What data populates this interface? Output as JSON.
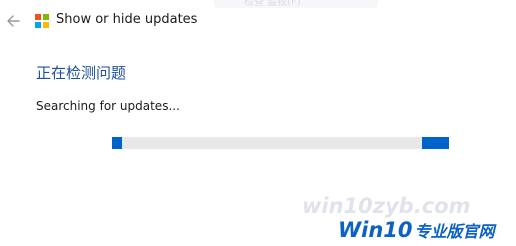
{
  "window": {
    "title": "Show or hide updates",
    "faded_search_text": "检查 监视(F)"
  },
  "icons": {
    "back": "back-arrow-icon",
    "logo": "microsoft-logo-icon"
  },
  "logo_colors": {
    "q1": "#f25022",
    "q2": "#7fba00",
    "q3": "#00a4ef",
    "q4": "#ffb900"
  },
  "main": {
    "heading": "正在检测问题",
    "status": "Searching for updates...",
    "progress_state": "indeterminate"
  },
  "colors": {
    "heading": "#1f4e9e",
    "progress_fill": "#0063c9",
    "progress_track": "#e8e8e8"
  },
  "watermark": {
    "url": "win10zyb.com",
    "brand_main": "Win10",
    "brand_sub": "专业版官网"
  }
}
